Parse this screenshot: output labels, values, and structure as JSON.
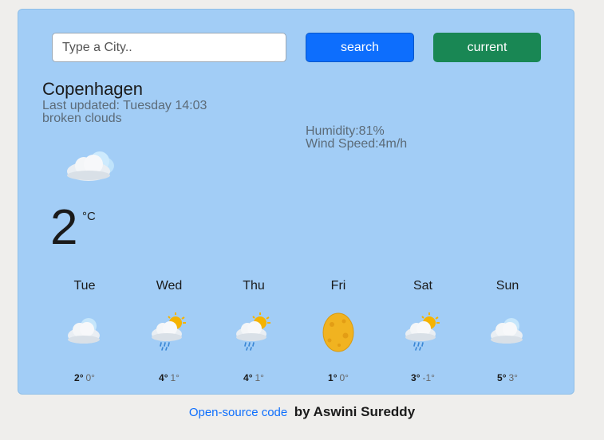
{
  "search": {
    "placeholder": "Type a City..",
    "value": ""
  },
  "buttons": {
    "search_label": "search",
    "current_label": "current"
  },
  "weather": {
    "city": "Copenhagen",
    "last_updated": "Last updated: Tuesday 14:03",
    "description": "broken clouds",
    "humidity": "Humidity:81%",
    "wind": "Wind Speed:4m/h",
    "temperature": "2",
    "unit": "°C",
    "icon": "broken-clouds-icon"
  },
  "forecast": [
    {
      "day": "Tue",
      "max": "2°",
      "min": "0°",
      "icon": "broken-clouds-icon"
    },
    {
      "day": "Wed",
      "max": "4°",
      "min": "1°",
      "icon": "rain-sun-icon"
    },
    {
      "day": "Thu",
      "max": "4°",
      "min": "1°",
      "icon": "rain-sun-icon"
    },
    {
      "day": "Fri",
      "max": "1°",
      "min": "0°",
      "icon": "moon-icon"
    },
    {
      "day": "Sat",
      "max": "3°",
      "min": "-1°",
      "icon": "rain-sun-icon"
    },
    {
      "day": "Sun",
      "max": "5°",
      "min": "3°",
      "icon": "broken-clouds-icon"
    }
  ],
  "footer": {
    "link_text": "Open-source code",
    "author": "by Aswini Sureddy"
  },
  "colors": {
    "card_bg": "#a2cdf6",
    "search_btn": "#0d6efd",
    "current_btn": "#198754",
    "link": "#0d6efd"
  }
}
